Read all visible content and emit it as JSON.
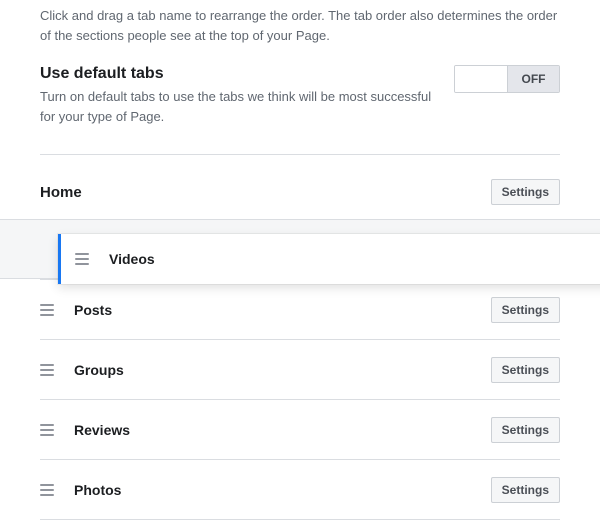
{
  "intro": "Click and drag a tab name to rearrange the order. The tab order also determines the order of the sections people see at the top of your Page.",
  "default_tabs": {
    "title": "Use default tabs",
    "description": "Turn on default tabs to use the tabs we think will be most successful for your type of Page.",
    "toggle_label": "OFF"
  },
  "home": {
    "label": "Home",
    "settings_label": "Settings"
  },
  "dragged_tab": {
    "label": "Videos"
  },
  "tabs": [
    {
      "label": "Posts",
      "settings_label": "Settings"
    },
    {
      "label": "Groups",
      "settings_label": "Settings"
    },
    {
      "label": "Reviews",
      "settings_label": "Settings"
    },
    {
      "label": "Photos",
      "settings_label": "Settings"
    }
  ]
}
